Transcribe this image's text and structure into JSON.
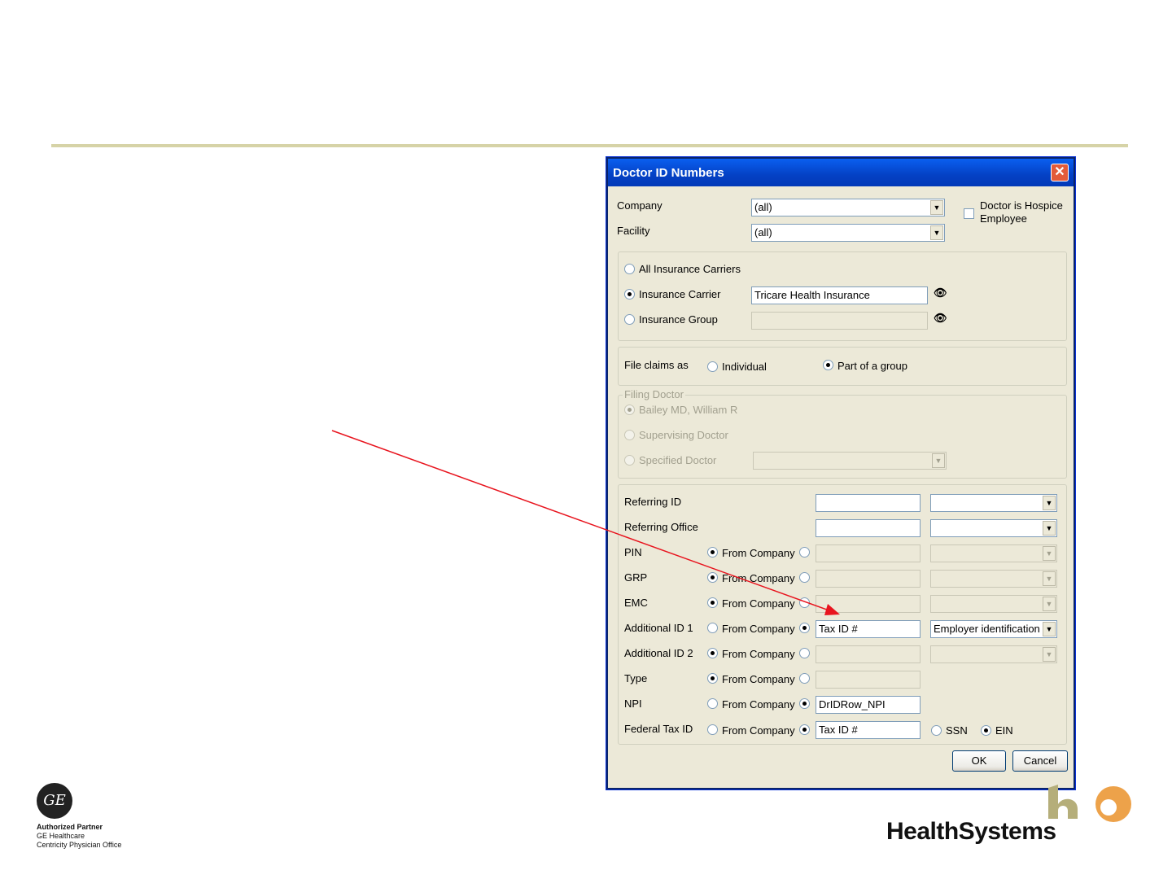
{
  "dialog": {
    "title": "Doctor ID Numbers",
    "close_label": "✕",
    "company_label": "Company",
    "company_value": "(all)",
    "facility_label": "Facility",
    "facility_value": "(all)",
    "hospice_label_line1": "Doctor is Hospice",
    "hospice_label_line2": "Employee",
    "all_carriers_label": "All Insurance Carriers",
    "carrier_label": "Insurance Carrier",
    "carrier_value": "Tricare Health Insurance",
    "group_label": "Insurance Group",
    "group_value": "",
    "file_claims_label": "File claims as",
    "individual_label": "Individual",
    "part_group_label": "Part of a group",
    "filing_doctor_legend": "Filing Doctor",
    "filing_doctor_name": "Bailey MD, William R",
    "supervising_label": "Supervising Doctor",
    "specified_label": "Specified Doctor",
    "referring_id_label": "Referring ID",
    "referring_office_label": "Referring Office",
    "from_company_label": "From Company",
    "rows": [
      {
        "label": "PIN",
        "value": "",
        "type_value": ""
      },
      {
        "label": "GRP",
        "value": "",
        "type_value": ""
      },
      {
        "label": "EMC",
        "value": "",
        "type_value": ""
      },
      {
        "label": "Additional ID 1",
        "value": "Tax ID #",
        "type_value": "Employer identification nu"
      },
      {
        "label": "Additional ID 2",
        "value": "",
        "type_value": ""
      },
      {
        "label": "Type",
        "value": ""
      },
      {
        "label": "NPI",
        "value": "DrIDRow_NPI"
      },
      {
        "label": "Federal Tax ID",
        "value": "Tax ID #"
      }
    ],
    "ssn_label": "SSN",
    "ein_label": "EIN",
    "ok_label": "OK",
    "cancel_label": "Cancel"
  },
  "annotation": {
    "color": "#e8141e"
  },
  "branding": {
    "ge_mark": "GE",
    "partner_line1": "Authorized Partner",
    "partner_line2": "GE Healthcare",
    "partner_line3": "Centricity Physician Office",
    "company_name": "HealthSystems",
    "colors": {
      "hs_olive": "#b5ae7a",
      "hs_orange": "#eda24a"
    }
  },
  "colors": {
    "rule": "#d6d3a7",
    "dialog_face": "#ece9d8",
    "titlebar": "#0a5ff0"
  }
}
